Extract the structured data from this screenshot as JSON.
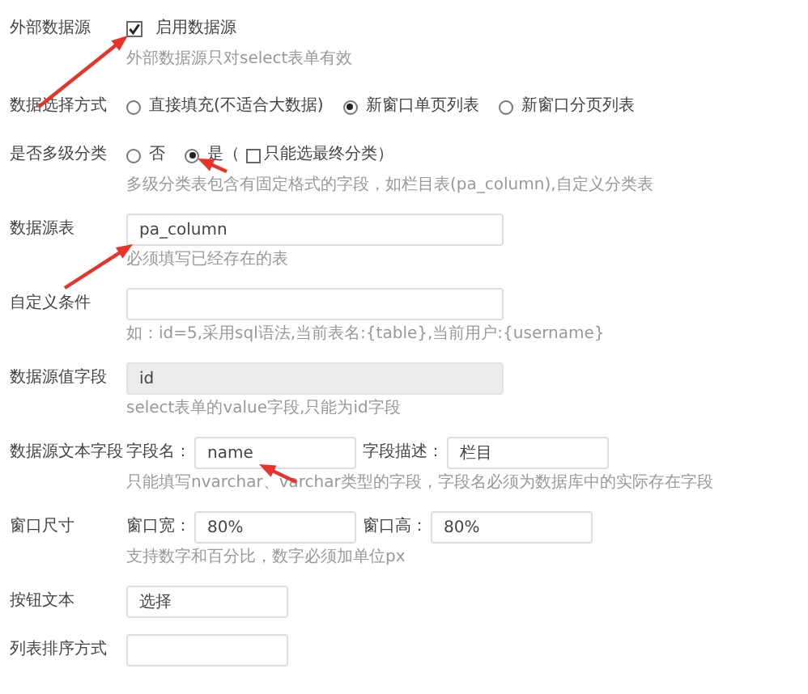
{
  "rows": [
    {
      "kind": "checkbox",
      "label": "外部数据源",
      "checkbox": {
        "label": "启用数据源",
        "checked": true
      },
      "hint": "外部数据源只对select表单有效",
      "pointer": true
    },
    {
      "kind": "radio",
      "label": "数据选择方式",
      "options": [
        {
          "label": "直接填充(不适合大数据)",
          "selected": false
        },
        {
          "label": "新窗口单页列表",
          "selected": true
        },
        {
          "label": "新窗口分页列表",
          "selected": false
        }
      ]
    },
    {
      "kind": "radio",
      "label": "是否多级分类",
      "options": [
        {
          "label": "否",
          "selected": false
        },
        {
          "label": "是（",
          "selected": true
        }
      ],
      "suffix": {
        "label": "只能选最终分类）",
        "checked": false
      },
      "hint": "多级分类表包含有固定格式的字段，如栏目表(pa_column),自定义分类表",
      "pointer": true
    },
    {
      "kind": "text",
      "label": "数据源表",
      "value": "pa_column",
      "hint": "必须填写已经存在的表",
      "pointer": true
    },
    {
      "kind": "text",
      "label": "自定义条件",
      "hint": "如：id=5,采用sql语法,当前表名:{table},当前用户:{username}"
    },
    {
      "kind": "text",
      "label": "数据源值字段",
      "value": "id",
      "disabled": true,
      "hint": "select表单的value字段,只能为id字段"
    },
    {
      "kind": "pair",
      "label": "数据源文本字段",
      "fields": [
        {
          "label": "字段名：",
          "value": "name"
        },
        {
          "label": "字段描述：",
          "value": "栏目"
        }
      ],
      "hint": "只能填写nvarchar、varchar类型的字段，字段名必须为数据库中的实际存在字段",
      "pointer": true
    },
    {
      "kind": "pair",
      "label": "窗口尺寸",
      "fields": [
        {
          "label": "窗口宽：",
          "value": "80%"
        },
        {
          "label": "窗口高：",
          "value": "80%"
        }
      ],
      "hint": "支持数字和百分比，数字必须加单位px"
    },
    {
      "kind": "text",
      "label": "按钮文本",
      "value": "选择",
      "short": true
    },
    {
      "kind": "text",
      "label": "列表排序方式",
      "short": true
    }
  ]
}
